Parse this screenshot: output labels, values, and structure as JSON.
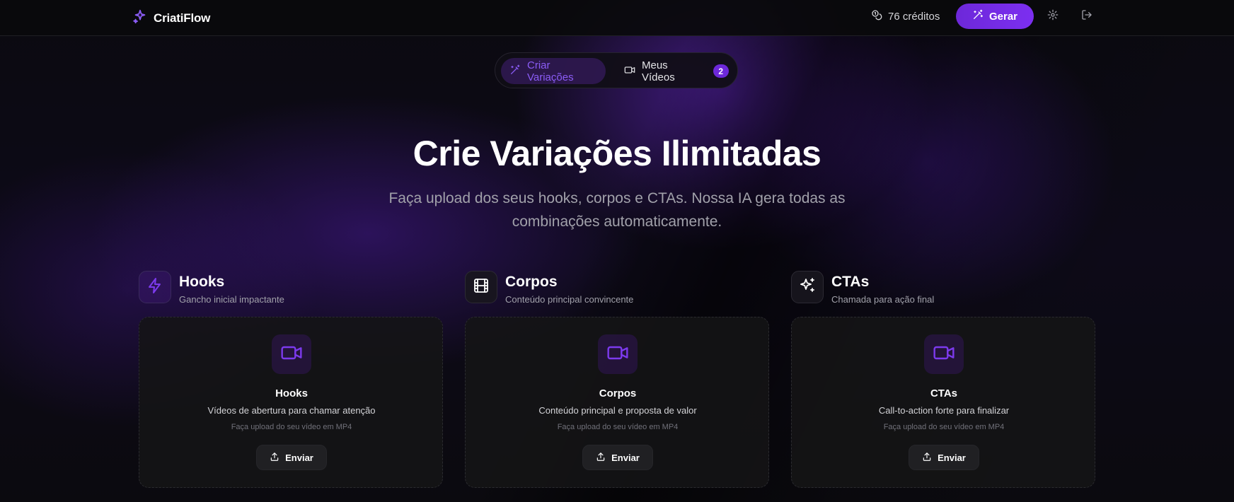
{
  "header": {
    "brand": "CriatiFlow",
    "credits_label": "76 créditos",
    "generate_label": "Gerar"
  },
  "tabs": [
    {
      "label": "Criar Variações",
      "active": true
    },
    {
      "label": "Meus Vídeos",
      "badge": "2",
      "active": false
    }
  ],
  "hero": {
    "title": "Crie Variações Ilimitadas",
    "subtitle": "Faça upload dos seus hooks, corpos e CTAs. Nossa IA gera todas as combinações automaticamente."
  },
  "sections": [
    {
      "title": "Hooks",
      "subtitle": "Gancho inicial impactante",
      "icon": "lightning-icon",
      "card_title": "Hooks",
      "card_desc": "Vídeos de abertura para chamar atenção",
      "card_hint": "Faça upload do seu vídeo em MP4",
      "button_label": "Enviar"
    },
    {
      "title": "Corpos",
      "subtitle": "Conteúdo principal convincente",
      "icon": "film-icon",
      "card_title": "Corpos",
      "card_desc": "Conteúdo principal e proposta de valor",
      "card_hint": "Faça upload do seu vídeo em MP4",
      "button_label": "Enviar"
    },
    {
      "title": "CTAs",
      "subtitle": "Chamada para ação final",
      "icon": "sparkles-icon",
      "card_title": "CTAs",
      "card_desc": "Call-to-action forte para finalizar",
      "card_hint": "Faça upload do seu vídeo em MP4",
      "button_label": "Enviar"
    }
  ],
  "colors": {
    "accent": "#7c3aed",
    "accent_text": "#8b5cf6",
    "background": "#0a0a0b",
    "card": "#141416"
  }
}
